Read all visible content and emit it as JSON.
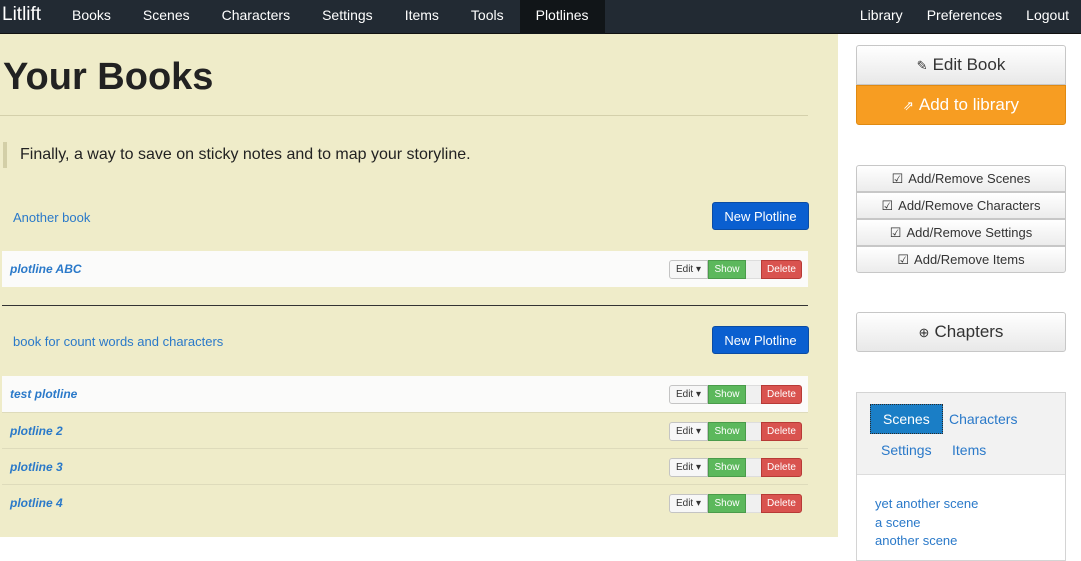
{
  "nav": {
    "brand": "Litlift",
    "left": [
      "Books",
      "Scenes",
      "Characters",
      "Settings",
      "Items",
      "Tools",
      "Plotlines"
    ],
    "right": [
      "Library",
      "Preferences",
      "Logout"
    ],
    "active": "Plotlines"
  },
  "main": {
    "title": "Your Books",
    "quote": "Finally, a way to save on sticky notes and to map your storyline.",
    "books": [
      {
        "title": "Another book",
        "new_plotline": "New Plotline",
        "plotlines": [
          "plotline ABC"
        ]
      },
      {
        "title": "book for count words and characters",
        "new_plotline": "New Plotline",
        "plotlines": [
          "test plotline",
          "plotline 2",
          "plotline 3",
          "plotline 4"
        ]
      }
    ],
    "row_buttons": {
      "edit": "Edit",
      "show": "Show",
      "delete": "Delete"
    }
  },
  "sidebar": {
    "edit_book": "Edit Book",
    "add_to_library": "Add to library",
    "add_remove": [
      "Add/Remove Scenes",
      "Add/Remove Characters",
      "Add/Remove Settings",
      "Add/Remove Items"
    ],
    "chapters": "Chapters",
    "tabs": [
      "Scenes",
      "Characters",
      "Settings",
      "Items"
    ],
    "selected_tab": "Scenes",
    "scenes": [
      "yet another scene",
      "a scene",
      "another scene"
    ]
  },
  "colors": {
    "navbar": "#222a33",
    "main_bg": "#efecc9",
    "primary": "#0a5fd0",
    "show": "#5cb85c",
    "delete": "#d9534f",
    "library": "#f79d22"
  }
}
